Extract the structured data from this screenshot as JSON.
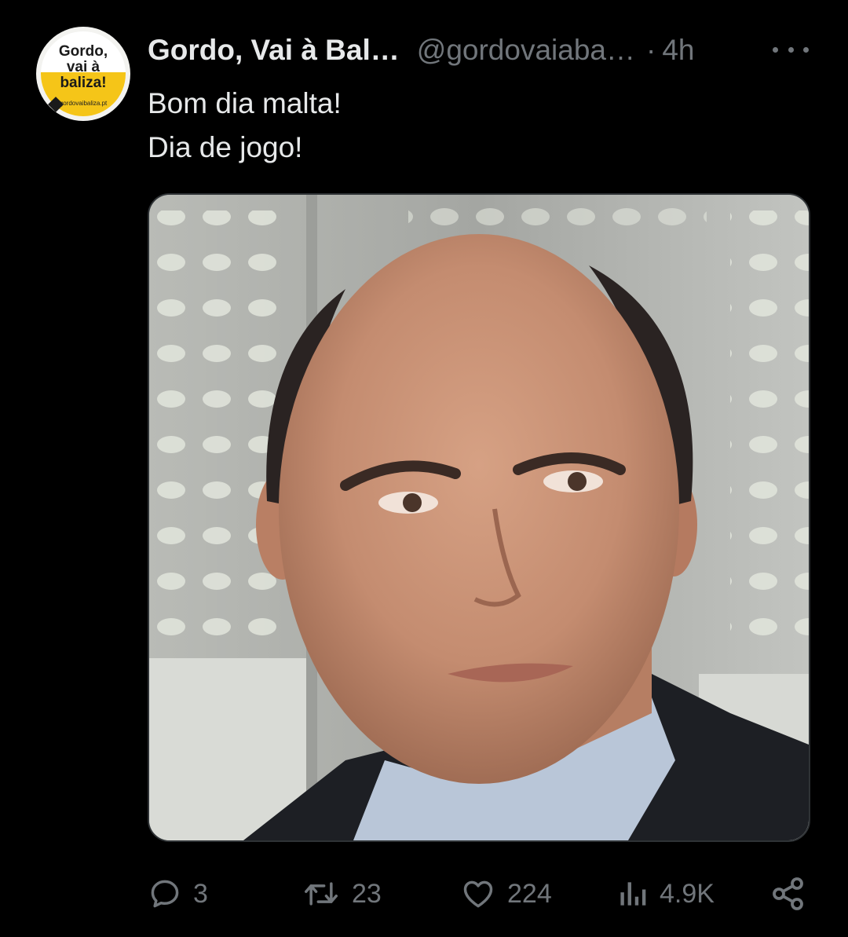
{
  "author": {
    "display_name": "Gordo, Vai à Bal…",
    "handle": "@gordovaiaba…",
    "separator": "·",
    "time": "4h",
    "avatar": {
      "logo_lines": [
        "Gordo,",
        "vai à",
        "baliza!"
      ],
      "logo_url": "gordovaibaliza.pt"
    }
  },
  "tweet": {
    "lines": [
      "Bom dia malta!",
      "Dia de jogo!"
    ]
  },
  "media": {
    "alt": "Photo of a balding man in a dark suit and light blue shirt"
  },
  "actions": {
    "replies": "3",
    "retweets": "23",
    "likes": "224",
    "views": "4.9K"
  },
  "colors": {
    "background": "#000000",
    "primary_text": "#e7e9ea",
    "secondary_text": "#71767b",
    "border": "#2f3336",
    "avatar_accent": "#f5c518"
  },
  "icons": {
    "reply": "reply-icon",
    "retweet": "retweet-icon",
    "like": "heart-icon",
    "views": "views-icon",
    "share": "share-icon",
    "more": "more-icon"
  }
}
